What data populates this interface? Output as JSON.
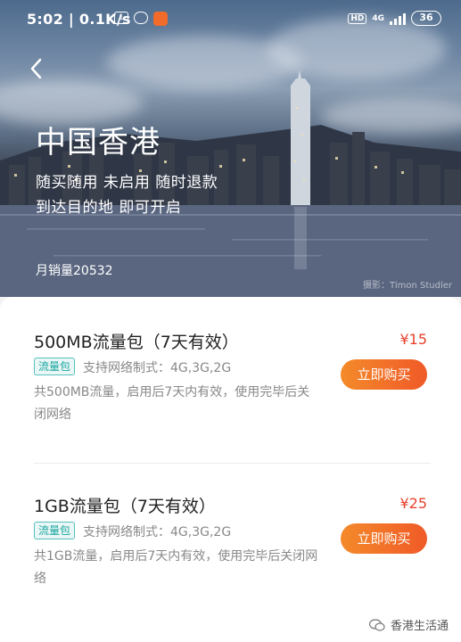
{
  "status_bar": {
    "time": "5:02 | 0.1K/s",
    "sim_label": "1",
    "hd_label": "HD",
    "network": "4G",
    "battery": "36"
  },
  "hero": {
    "title": "中国香港",
    "subtitle_line1": "随买随用 未启用 随时退款",
    "subtitle_line2": "到达目的地 即可开启",
    "monthly_sales": "月销量20532",
    "photo_credit": "摄影：Timon Studler"
  },
  "packages": [
    {
      "title": "500MB流量包（7天有效）",
      "price": "¥15",
      "badge": "流量包",
      "support": "支持网络制式：4G,3G,2G",
      "description": "共500MB流量，启用后7天内有效，使用完毕后关闭网络",
      "buy_label": "立即购买"
    },
    {
      "title": "1GB流量包（7天有效）",
      "price": "¥25",
      "badge": "流量包",
      "support": "支持网络制式：4G,3G,2G",
      "description": "共1GB流量，启用后7天内有效，使用完毕后关闭网络",
      "buy_label": "立即购买"
    }
  ],
  "watermark": "香港生活通",
  "colors": {
    "accent_orange": "#f05a28",
    "price_red": "#e8412c",
    "badge_teal": "#18a5a0"
  }
}
